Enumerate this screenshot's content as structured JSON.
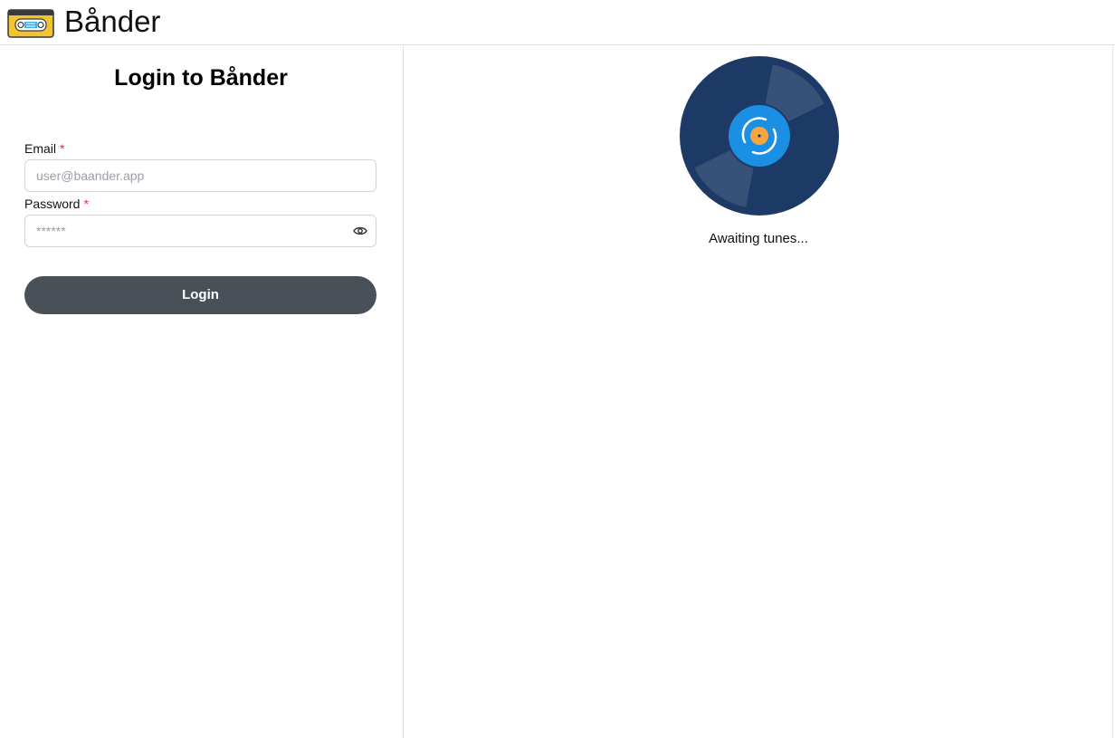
{
  "header": {
    "logo_icon": "cassette-tape-icon",
    "app_title": "Bånder"
  },
  "login": {
    "title": "Login to Bånder",
    "email": {
      "label": "Email",
      "required_mark": "*",
      "placeholder": "user@baander.app",
      "value": ""
    },
    "password": {
      "label": "Password",
      "required_mark": "*",
      "placeholder": "******",
      "value": "",
      "toggle_icon": "eye-icon"
    },
    "submit_label": "Login"
  },
  "player": {
    "disc_icon": "vinyl-record-icon",
    "status": "Awaiting tunes..."
  },
  "colors": {
    "button_bg": "#4a5058",
    "required": "#e03131",
    "vinyl_dark": "#1d3a66",
    "vinyl_label": "#1a8fe3",
    "vinyl_center": "#f7a541"
  }
}
